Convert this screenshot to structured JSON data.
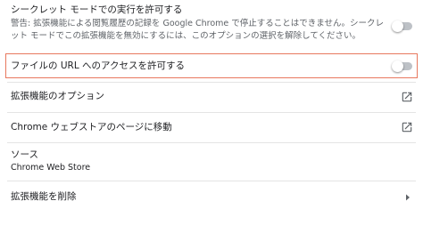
{
  "incognito": {
    "title": "シークレット モードでの実行を許可する",
    "description": "警告: 拡張機能による閲覧履歴の記録を Google Chrome で停止することはできません。シークレット モードでこの拡張機能を無効にするには、このオプションの選択を解除してください。",
    "enabled": false
  },
  "file_urls": {
    "title": "ファイルの URL へのアクセスを許可する",
    "enabled": false
  },
  "extension_options": {
    "title": "拡張機能のオプション",
    "icon": "open-in-new-icon"
  },
  "chrome_store": {
    "title": "Chrome ウェブストアのページに移動",
    "icon": "open-in-new-icon"
  },
  "source": {
    "label": "ソース",
    "value": "Chrome Web Store"
  },
  "remove": {
    "title": "拡張機能を削除",
    "icon": "chevron-right-icon"
  },
  "colors": {
    "highlight_border": "#e8785e",
    "toggle_off": "#bdc1c6"
  }
}
